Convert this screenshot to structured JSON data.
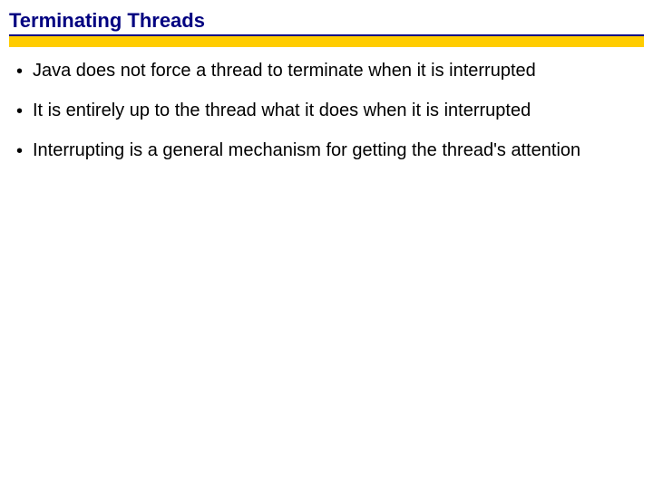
{
  "colors": {
    "title_color": "#000080",
    "accent_yellow": "#ffcc00"
  },
  "title": "Terminating Threads",
  "bullets": [
    "Java does not force a thread to terminate when it is interrupted",
    "It is entirely up to the thread what it does when it is interrupted",
    "Interrupting is a general mechanism for getting the thread's attention"
  ]
}
